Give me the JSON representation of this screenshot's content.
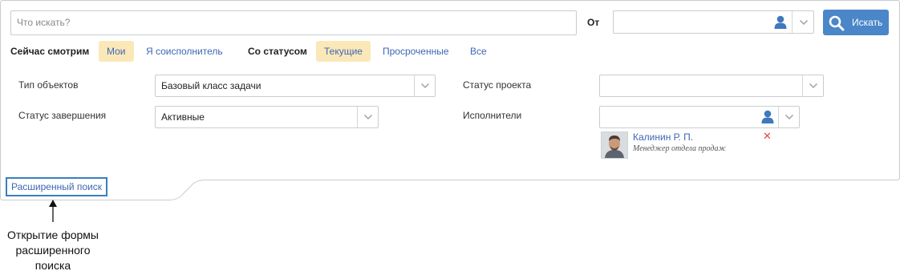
{
  "search": {
    "placeholder": "Что искать?",
    "from_label": "От",
    "from_value": "",
    "button_label": "Искать"
  },
  "filters": {
    "watching_label": "Сейчас смотрим",
    "watching_tabs": [
      {
        "label": "Мои",
        "active": true
      },
      {
        "label": "Я соисполнитель",
        "active": false
      }
    ],
    "status_label": "Со статусом",
    "status_tabs": [
      {
        "label": "Текущие",
        "active": true
      },
      {
        "label": "Просроченные",
        "active": false
      },
      {
        "label": "Все",
        "active": false
      }
    ]
  },
  "fields": {
    "object_type": {
      "label": "Тип объектов",
      "value": "Базовый класс задачи"
    },
    "completion_status": {
      "label": "Статус завершения",
      "value": "Активные"
    },
    "project_status": {
      "label": "Статус проекта",
      "value": ""
    },
    "performers": {
      "label": "Исполнители",
      "value": ""
    }
  },
  "performer": {
    "name": "Калинин Р. П.",
    "role": "Менеджер отдела продаж",
    "remove_symbol": "✕"
  },
  "advanced_search": {
    "label": "Расширенный поиск"
  },
  "annotation": {
    "lines": [
      "Открытие формы",
      "расширенного",
      "поиска"
    ]
  },
  "colors": {
    "accent": "#4a86c8",
    "link": "#3e66b5",
    "active_tab_bg": "#fbe8b8",
    "remove": "#e04b3b",
    "highlight_border": "#3a7fc0"
  },
  "icons": {
    "search": "search-icon",
    "user": "user-icon",
    "dropdown": "chevron-down-icon",
    "remove": "close-icon",
    "arrow": "arrow-up-icon"
  }
}
